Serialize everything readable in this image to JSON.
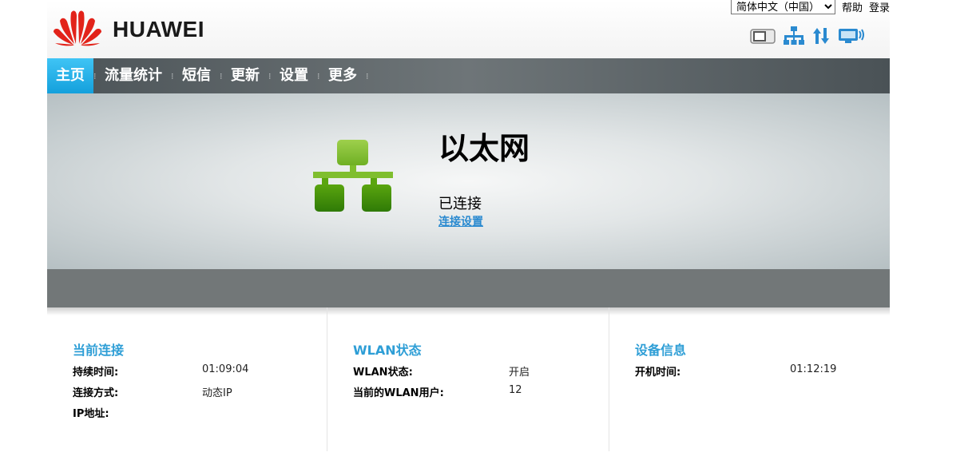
{
  "header": {
    "brand": "HUAWEI",
    "language": "简体中文（中国）",
    "help_label": "帮助",
    "login_label": "登录",
    "status_icons": [
      "sim-card-icon",
      "ethernet-icon",
      "data-transfer-icon",
      "wifi-display-icon"
    ]
  },
  "nav": {
    "items": [
      {
        "label": "主页",
        "active": true
      },
      {
        "label": "流量统计",
        "active": false
      },
      {
        "label": "短信",
        "active": false
      },
      {
        "label": "更新",
        "active": false
      },
      {
        "label": "设置",
        "active": false
      },
      {
        "label": "更多",
        "active": false
      }
    ]
  },
  "hero": {
    "title": "以太网",
    "status": "已连接",
    "link": "连接设置",
    "icon": "ethernet-network-icon"
  },
  "panels": [
    {
      "title": "当前连接",
      "rows": [
        {
          "key": "持续时间:",
          "value": "01:09:04"
        },
        {
          "key": "连接方式:",
          "value": "动态IP"
        },
        {
          "key": "IP地址:",
          "value": ""
        }
      ]
    },
    {
      "title": "WLAN状态",
      "rows": [
        {
          "key": "WLAN状态:",
          "value": "开启"
        },
        {
          "key": "当前的WLAN用户:",
          "value": "12"
        }
      ]
    },
    {
      "title": "设备信息",
      "rows": [
        {
          "key": "开机时间:",
          "value": "01:12:19"
        }
      ]
    }
  ],
  "colors": {
    "accent": "#2e9ed6",
    "nav_active": "#1aa6e0",
    "brand_red": "#e2231a",
    "network_green": "#5aa50f"
  }
}
